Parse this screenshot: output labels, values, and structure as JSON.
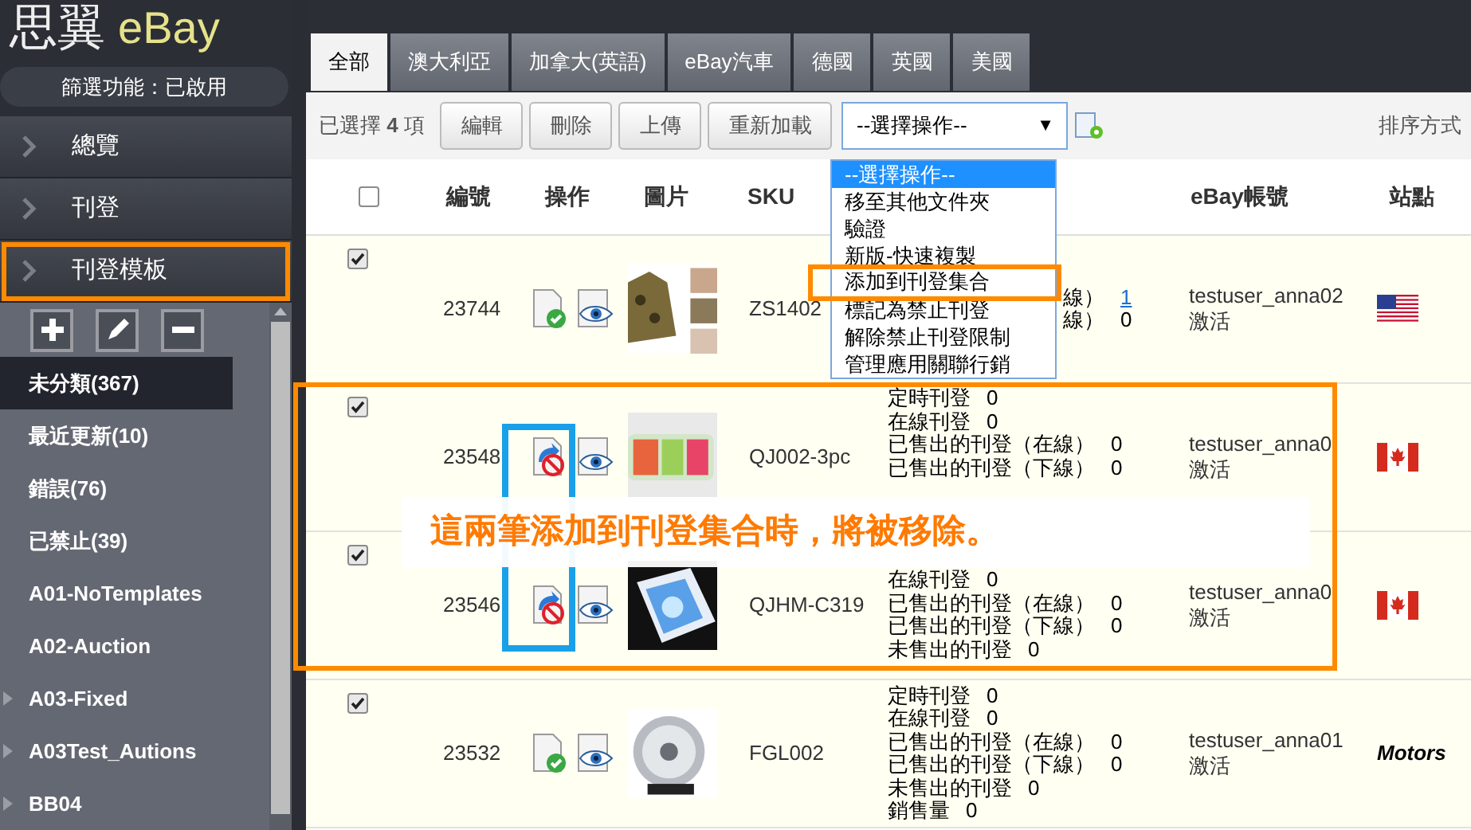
{
  "logo": {
    "name": "思翼",
    "brand": "eBay"
  },
  "filter_status": "篩選功能：已啟用",
  "nav": [
    {
      "label": "總覽",
      "highlighted": false
    },
    {
      "label": "刊登",
      "highlighted": false
    },
    {
      "label": "刊登模板",
      "highlighted": true
    }
  ],
  "categories": [
    {
      "label": "未分類(367)",
      "selected": true,
      "expandable": false
    },
    {
      "label": "最近更新(10)",
      "selected": false,
      "expandable": false
    },
    {
      "label": "錯誤(76)",
      "selected": false,
      "expandable": false
    },
    {
      "label": "已禁止(39)",
      "selected": false,
      "expandable": false
    },
    {
      "label": "A01-NoTemplates",
      "selected": false,
      "expandable": false
    },
    {
      "label": "A02-Auction",
      "selected": false,
      "expandable": false
    },
    {
      "label": "A03-Fixed",
      "selected": false,
      "expandable": true
    },
    {
      "label": "A03Test_Autions",
      "selected": false,
      "expandable": true
    },
    {
      "label": "BB04",
      "selected": false,
      "expandable": true
    }
  ],
  "tabs": [
    {
      "label": "全部",
      "selected": true
    },
    {
      "label": "澳大利亞",
      "selected": false
    },
    {
      "label": "加拿大(英語)",
      "selected": false
    },
    {
      "label": "eBay汽車",
      "selected": false
    },
    {
      "label": "德國",
      "selected": false
    },
    {
      "label": "英國",
      "selected": false
    },
    {
      "label": "美國",
      "selected": false
    }
  ],
  "selection_count": "已選擇 **4** 項",
  "buttons": [
    "編輯",
    "刪除",
    "上傳",
    "重新加載"
  ],
  "action_select": {
    "value": "--選擇操作--",
    "arrow": "▼"
  },
  "action_menu": [
    {
      "label": "--選擇操作--",
      "selected": true,
      "highlighted": false
    },
    {
      "label": "移至其他文件夾",
      "selected": false,
      "highlighted": false
    },
    {
      "label": "驗證",
      "selected": false,
      "highlighted": false
    },
    {
      "label": "新版-快速複製",
      "selected": false,
      "highlighted": false
    },
    {
      "label": "添加到刊登集合",
      "selected": false,
      "highlighted": true
    },
    {
      "label": "標記為禁止刊登",
      "selected": false,
      "highlighted": false
    },
    {
      "label": "解除禁止刊登限制",
      "selected": false,
      "highlighted": false
    },
    {
      "label": "管理應用關聯行銷",
      "selected": false,
      "highlighted": false
    }
  ],
  "sort_label": "排序方式",
  "table": {
    "header_checked": false,
    "columns": [
      "編號",
      "操作",
      "圖片",
      "SKU",
      "eBay帳號",
      "站點"
    ],
    "rows": [
      {
        "checked": true,
        "id": "23744",
        "kind": "ok",
        "sku": "ZS1402",
        "stats": [
          {
            "kind": "partial",
            "label": "線）",
            "value": "1",
            "link": true
          },
          {
            "kind": "partial",
            "label": "線）",
            "value": "0",
            "link": false
          }
        ],
        "account": "testuser_anna02",
        "account_status": "激活",
        "site": {
          "kind": "us"
        }
      },
      {
        "checked": true,
        "id": "23548",
        "kind": "blocked",
        "sku": "QJ002-3pc",
        "stats": [
          {
            "kind": "full",
            "label": "定時刊登",
            "value": "0",
            "link": false
          },
          {
            "kind": "full",
            "label": "在線刊登",
            "value": "0",
            "link": false
          },
          {
            "kind": "full",
            "label": "已售出的刊登（在線）",
            "value": "0",
            "link": false
          },
          {
            "kind": "full",
            "label": "已售出的刊登（下線）",
            "value": "0",
            "link": false
          }
        ],
        "account": "testuser_anna0",
        "account_status": "激活",
        "site": {
          "kind": "ca"
        }
      },
      {
        "checked": true,
        "id": "23546",
        "kind": "blocked",
        "sku": "QJHM-C319",
        "stats": [
          {
            "kind": "full",
            "label": "在線刊登",
            "value": "0",
            "link": false
          },
          {
            "kind": "full",
            "label": "已售出的刊登（在線）",
            "value": "0",
            "link": false
          },
          {
            "kind": "full",
            "label": "已售出的刊登（下線）",
            "value": "0",
            "link": false
          },
          {
            "kind": "full",
            "label": "未售出的刊登",
            "value": "0",
            "link": false
          }
        ],
        "account": "testuser_anna0",
        "account_status": "激活",
        "site": {
          "kind": "ca"
        }
      },
      {
        "checked": true,
        "id": "23532",
        "kind": "ok",
        "sku": "FGL002",
        "stats": [
          {
            "kind": "full",
            "label": "定時刊登",
            "value": "0",
            "link": false
          },
          {
            "kind": "full",
            "label": "在線刊登",
            "value": "0",
            "link": false
          },
          {
            "kind": "full",
            "label": "已售出的刊登（在線）",
            "value": "0",
            "link": false
          },
          {
            "kind": "full",
            "label": "已售出的刊登（下線）",
            "value": "0",
            "link": false
          },
          {
            "kind": "full",
            "label": "未售出的刊登",
            "value": "0",
            "link": false
          },
          {
            "kind": "full",
            "label": "銷售量",
            "value": "0",
            "link": false
          }
        ],
        "account": "testuser_anna01",
        "account_status": "激活",
        "site": {
          "kind": "motors",
          "label": "Motors"
        }
      }
    ]
  },
  "annotation": {
    "text": "這兩筆添加到刊登集合時，將被移除。",
    "marked_rows": true
  }
}
